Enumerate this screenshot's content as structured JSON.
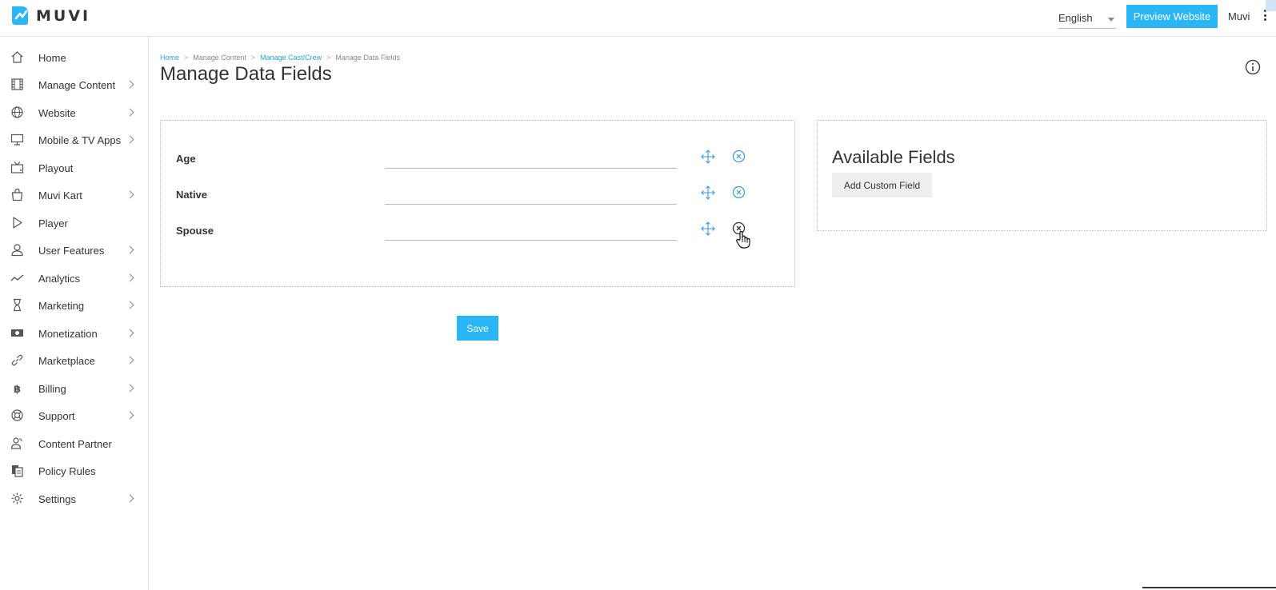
{
  "header": {
    "logo_text": "MUVI",
    "language": "English",
    "preview_button": "Preview Website",
    "user_name": "Muvi",
    "accent_color": "#29b6f6"
  },
  "sidebar": {
    "items": [
      {
        "label": "Home",
        "icon": "home-icon",
        "has_submenu": false
      },
      {
        "label": "Manage Content",
        "icon": "film-icon",
        "has_submenu": true
      },
      {
        "label": "Website",
        "icon": "globe-icon",
        "has_submenu": true
      },
      {
        "label": "Mobile & TV Apps",
        "icon": "monitor-icon",
        "has_submenu": true
      },
      {
        "label": "Playout",
        "icon": "tv-icon",
        "has_submenu": false
      },
      {
        "label": "Muvi Kart",
        "icon": "shopping-bag-icon",
        "has_submenu": true
      },
      {
        "label": "Player",
        "icon": "play-icon",
        "has_submenu": false
      },
      {
        "label": "User Features",
        "icon": "user-icon",
        "has_submenu": true
      },
      {
        "label": "Analytics",
        "icon": "trend-icon",
        "has_submenu": true
      },
      {
        "label": "Marketing",
        "icon": "hourglass-icon",
        "has_submenu": true
      },
      {
        "label": "Monetization",
        "icon": "money-icon",
        "has_submenu": true
      },
      {
        "label": "Marketplace",
        "icon": "link-icon",
        "has_submenu": true
      },
      {
        "label": "Billing",
        "icon": "bitcoin-icon",
        "has_submenu": true
      },
      {
        "label": "Support",
        "icon": "lifebuoy-icon",
        "has_submenu": true
      },
      {
        "label": "Content Partner",
        "icon": "partner-icon",
        "has_submenu": false
      },
      {
        "label": "Policy Rules",
        "icon": "policy-icon",
        "has_submenu": false
      },
      {
        "label": "Settings",
        "icon": "gear-icon",
        "has_submenu": true
      }
    ]
  },
  "breadcrumb": {
    "items": [
      "Home",
      "Manage Content",
      "Manage Cast/Crew",
      "Manage Data Fields"
    ],
    "separator": ">"
  },
  "page": {
    "title": "Manage Data Fields"
  },
  "fields": [
    {
      "label": "Age",
      "value": ""
    },
    {
      "label": "Native",
      "value": ""
    },
    {
      "label": "Spouse",
      "value": ""
    }
  ],
  "actions": {
    "save_label": "Save"
  },
  "available": {
    "title": "Available Fields",
    "add_button": "Add Custom Field"
  }
}
